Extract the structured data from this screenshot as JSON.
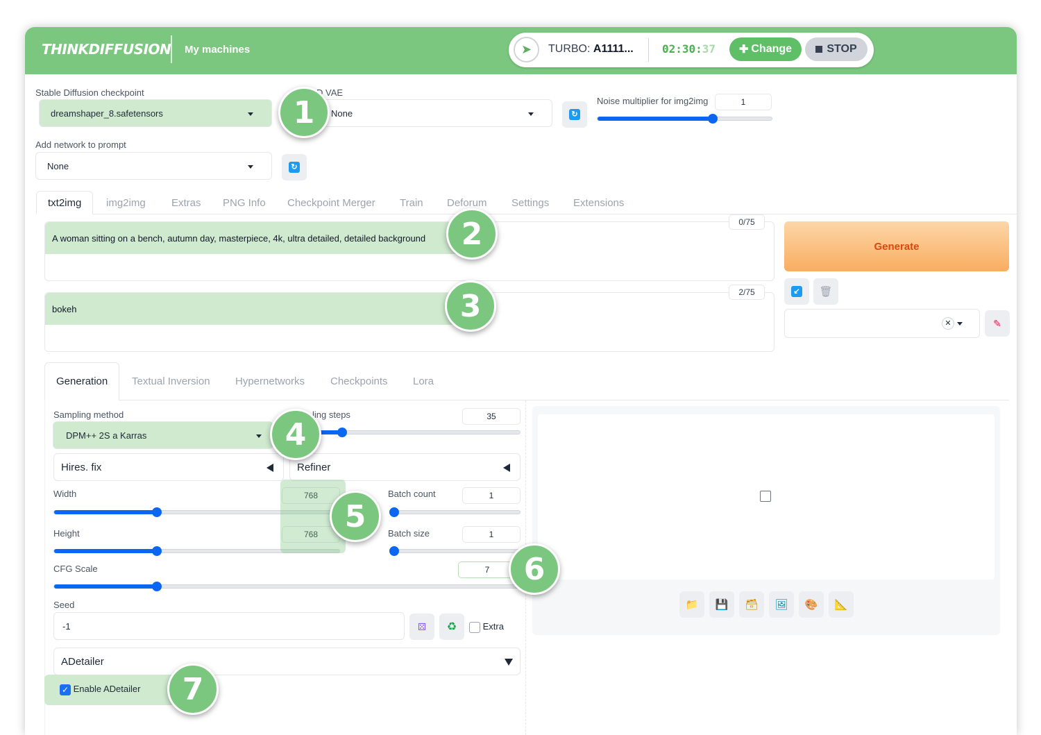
{
  "header": {
    "logo": "THINKDIFFUSION",
    "my_machines": "My machines",
    "machine_prefix": "TURBO: ",
    "machine_name": "A1111...",
    "timer_main": "02:30:",
    "timer_sec": "37",
    "change_label": "Change",
    "stop_label": "STOP"
  },
  "settings": {
    "checkpoint_label": "Stable Diffusion checkpoint",
    "checkpoint_value": "dreamshaper_8.safetensors",
    "vae_label": "D VAE",
    "vae_value": "None",
    "noise_label": "Noise multiplier for img2img",
    "noise_value": "1",
    "noise_fraction": 0.66,
    "network_label": "Add network to prompt",
    "network_value": "None"
  },
  "tabs": [
    "txt2img",
    "img2img",
    "Extras",
    "PNG Info",
    "Checkpoint Merger",
    "Train",
    "Deforum",
    "Settings",
    "Extensions"
  ],
  "prompts": {
    "positive": "A woman sitting on a bench, autumn day, masterpiece, 4k, ultra detailed, detailed background",
    "positive_count": "0/75",
    "negative": "bokeh",
    "negative_count": "2/75"
  },
  "actions": {
    "generate_label": "Generate"
  },
  "subtabs": [
    "Generation",
    "Textual Inversion",
    "Hypernetworks",
    "Checkpoints",
    "Lora"
  ],
  "generation": {
    "sampling_method_label": "Sampling method",
    "sampling_method_value": "DPM++ 2S a Karras",
    "sampling_steps_label": "ling steps",
    "sampling_steps_value": "35",
    "sampling_steps_fraction": 0.25,
    "hires_label": "Hires. fix",
    "refiner_label": "Refiner",
    "width_label": "Width",
    "width_value": "768",
    "width_fraction": 0.36,
    "height_label": "Height",
    "height_value": "768",
    "height_fraction": 0.36,
    "batch_count_label": "Batch count",
    "batch_count_value": "1",
    "batch_count_fraction": 0.0,
    "batch_size_label": "Batch size",
    "batch_size_value": "1",
    "batch_size_fraction": 0.0,
    "cfg_label": "CFG Scale",
    "cfg_value": "7",
    "cfg_fraction": 0.22,
    "seed_label": "Seed",
    "seed_value": "-1",
    "extra_label": "Extra",
    "adetailer_label": "ADetailer",
    "enable_adetailer_label": "Enable ADetailer"
  },
  "callouts": [
    "1",
    "2",
    "3",
    "4",
    "5",
    "6",
    "7"
  ],
  "colors": {
    "brand_green": "#7bc77f",
    "slider_blue": "#0b67f2",
    "generate_orange": "#f9ad5f"
  }
}
